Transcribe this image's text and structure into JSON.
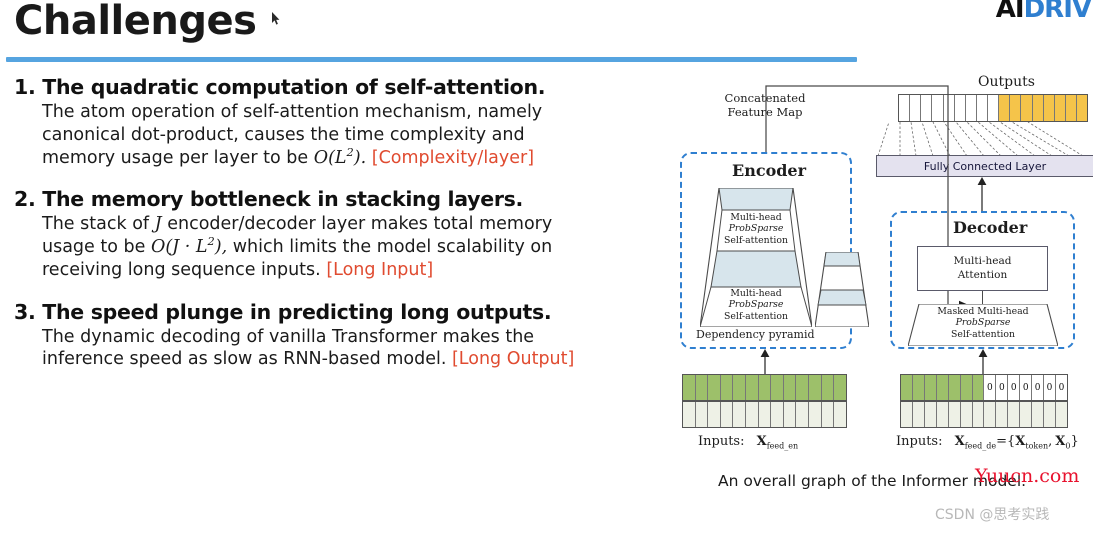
{
  "slide": {
    "title": "Challenges",
    "rule_color": "#56a4e0",
    "accent_red": "#e04b30"
  },
  "brand": {
    "text_a": "AI",
    "text_b": "DRIV"
  },
  "challenges": [
    {
      "number": "1.",
      "heading": "The quadratic computation of self-attention.",
      "line1_a": "The",
      "line1_b": "atom",
      "line1_c": "operation",
      "line1_d": "of",
      "line1_e": "self-attention",
      "line1_f": "mechanism,",
      "line1_g": "namely",
      "line2_a": "canonical",
      "line2_b": "dot-product,",
      "line2_c": "causes",
      "line2_d": "the",
      "line2_e": "time",
      "line2_f": "complexity",
      "line2_g": "and",
      "line3_prefix": "memory usage per layer to be ",
      "line3_math_o": "O",
      "line3_math_body": "(L",
      "line3_math_exp": "2",
      "line3_math_tail": ").",
      "tag": "[Complexity/layer]"
    },
    {
      "number": "2.",
      "heading": "The memory bottleneck in stacking layers.",
      "line1_a": "The",
      "line1_b": "stack",
      "line1_c": "of",
      "line1_d": "J",
      "line1_e": "encoder/decoder",
      "line1_f": "layer",
      "line1_g": "makes",
      "line1_h": "total",
      "line1_i": "memory",
      "line2_prefix": "usage",
      "line2_b": "to",
      "line2_c": "be",
      "line2_math_o": "O",
      "line2_math_body": "(J · L",
      "line2_math_exp": "2",
      "line2_math_tail": "),",
      "line2_d": "which",
      "line2_e": "limits",
      "line2_f": "the",
      "line2_g": "model",
      "line2_h": "scalability",
      "line2_i": "on",
      "line3": "receiving long sequence inputs.",
      "tag": "[Long Input]"
    },
    {
      "number": "3.",
      "heading": "The speed plunge in predicting long outputs.",
      "line1_a": "The",
      "line1_b": "dynamic",
      "line1_c": "decoding",
      "line1_d": "of",
      "line1_e": "vanilla",
      "line1_f": "Transformer",
      "line1_g": "makes",
      "line1_h": "the",
      "line2": "inference speed as slow as RNN-based model.",
      "tag": "[Long Output]"
    }
  ],
  "diagram": {
    "outputs_label": "Outputs",
    "concat_label_line1": "Concatenated",
    "concat_label_line2": "Feature Map",
    "encoder_label": "Encoder",
    "decoder_label": "Decoder",
    "fully_connected_label": "Fully Connected Layer",
    "dependency_pyramid_label": "Dependency pyramid",
    "enc_block_a_l1": "Multi-head",
    "enc_block_a_l2": "ProbSparse",
    "enc_block_a_l3": "Self-attention",
    "enc_block_b_l1": "Multi-head",
    "enc_block_b_l2": "ProbSparse",
    "enc_block_b_l3": "Self-attention",
    "dec_attn_l1": "Multi-head",
    "dec_attn_l2": "Attention",
    "dec_masked_l1": "Masked Multi-head",
    "dec_masked_l2": "ProbSparse",
    "dec_masked_l3": "Self-attention",
    "inputs_enc_label": "Inputs:",
    "inputs_enc_symbol": "X",
    "inputs_enc_sub": "feed_en",
    "inputs_dec_label": "Inputs:",
    "inputs_dec_symbol": "X",
    "inputs_dec_sub": "feed_de",
    "inputs_dec_eq": "={",
    "inputs_dec_tok": "X",
    "inputs_dec_tok_sub": "token",
    "inputs_dec_comma": ",",
    "inputs_dec_zero": "X",
    "inputs_dec_zero_sub": "0",
    "inputs_dec_close": "}",
    "zero_token": "0",
    "zero_count": 7,
    "output_white_cells": 9,
    "output_orange_cells": 8,
    "enc_input_cells": 13,
    "dec_input_green_cells": 7,
    "colors": {
      "orange": "#f5c44a",
      "green": "#9dc06a",
      "green_pale": "#eef1e6",
      "pyramid_fill": "#d7e5ec",
      "fc_fill": "#e4e2ef",
      "dashed_blue": "#2f7fd0"
    }
  },
  "caption": "An overall graph of the Informer model.",
  "watermarks": {
    "red": "Yuucn.com",
    "csdn": "CSDN @思考实践"
  }
}
